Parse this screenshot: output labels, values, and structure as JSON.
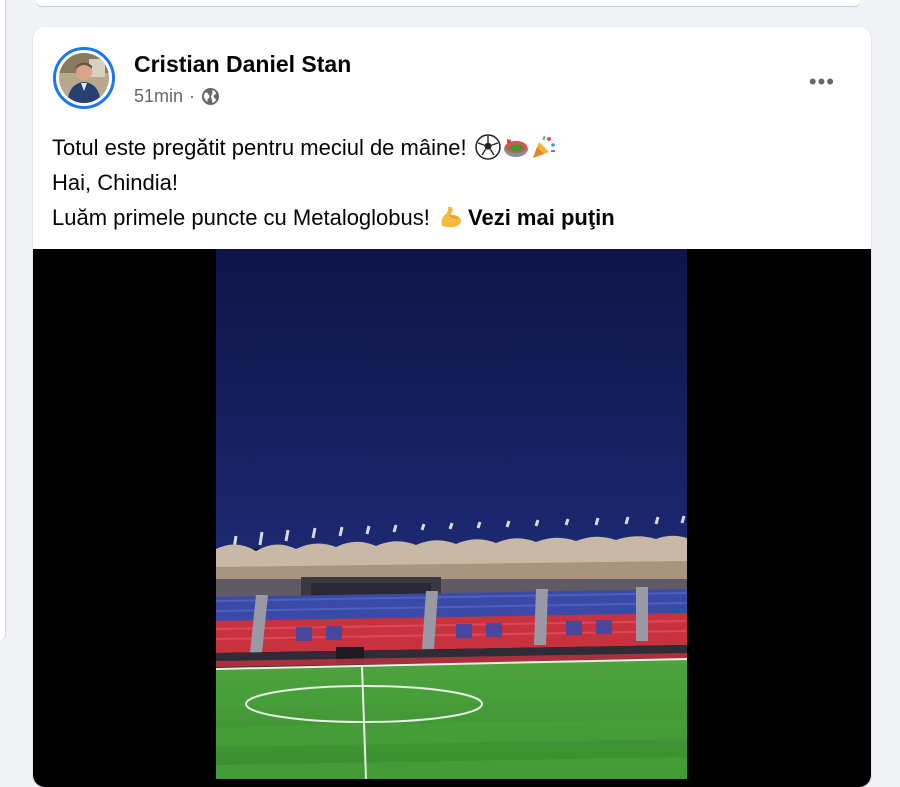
{
  "post": {
    "author": "Cristian Daniel Stan",
    "time": "51min",
    "separator": "·",
    "more_label": "•••",
    "text_lines": [
      "Totul este pregătit pentru meciul de mâine!",
      "Hai, Chindia!",
      "Luăm primele puncte cu Metaloglobus!"
    ],
    "see_less": "Vezi mai puţin",
    "emojis": [
      "soccer-ball-emoji",
      "stadium-emoji",
      "party-popper-emoji",
      "flexed-biceps-emoji"
    ]
  },
  "colors": {
    "story_ring": "#1877f2",
    "meta_text": "#65676b",
    "sky": "#131c56",
    "pitch": "#3f9a36",
    "seats_red": "#c8323e",
    "seats_blue": "#3b4aa6"
  }
}
